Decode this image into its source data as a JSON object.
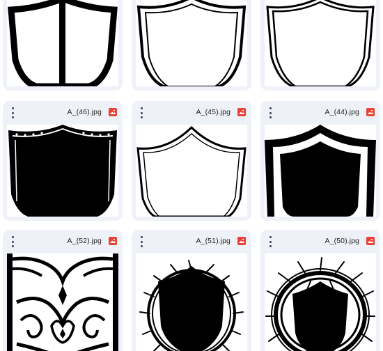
{
  "files": [
    {
      "name": "",
      "icon": "image-file-icon",
      "art": "shield-center-bar"
    },
    {
      "name": "",
      "icon": "image-file-icon",
      "art": "shield-double-outline"
    },
    {
      "name": "",
      "icon": "image-file-icon",
      "art": "shield-thin-double"
    },
    {
      "name": "A_(46).jpg",
      "icon": "image-file-icon",
      "art": "shield-black-ornate"
    },
    {
      "name": "A_(45).jpg",
      "icon": "image-file-icon",
      "art": "shield-white-outline"
    },
    {
      "name": "A_(44).jpg",
      "icon": "image-file-icon",
      "art": "shield-black-bordered"
    },
    {
      "name": "A_(52).jpg",
      "icon": "image-file-icon",
      "art": "tribal-pattern"
    },
    {
      "name": "A_(51).jpg",
      "icon": "image-file-icon",
      "art": "shield-thorn-crown"
    },
    {
      "name": "A_(50).jpg",
      "icon": "image-file-icon",
      "art": "shield-thorn-wreath"
    }
  ],
  "colors": {
    "card_bg": "#eef2f8",
    "icon_red": "#e94235",
    "text": "#1f1f1f"
  }
}
